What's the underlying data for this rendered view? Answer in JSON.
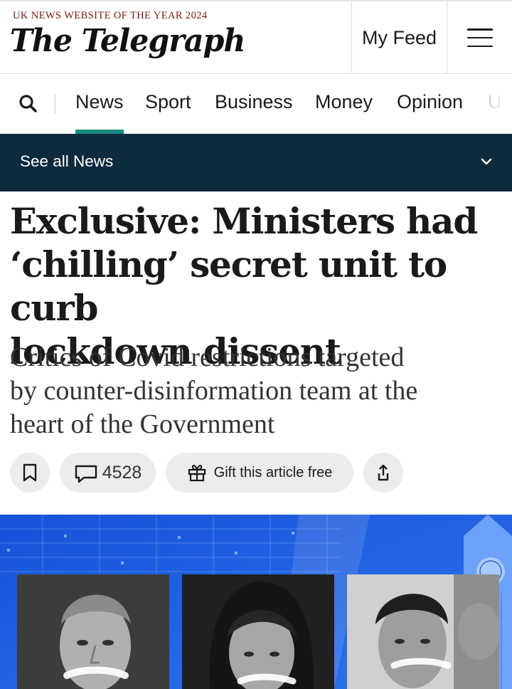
{
  "masthead": {
    "award": "UK NEWS WEBSITE OF THE YEAR 2024",
    "logo_text": "The Telegraph",
    "my_feed_label": "My Feed",
    "menu_icon": "hamburger-icon"
  },
  "nav": {
    "search_icon": "search-icon",
    "items": [
      {
        "label": "News",
        "active": true
      },
      {
        "label": "Sport",
        "active": false
      },
      {
        "label": "Business",
        "active": false
      },
      {
        "label": "Money",
        "active": false
      },
      {
        "label": "Opinion",
        "active": false
      },
      {
        "label": "U",
        "active": false
      }
    ],
    "active_color": "#1a8a80"
  },
  "section_bar": {
    "label": "See all News",
    "icon": "chevron-down-icon",
    "background": "#0e2a3d"
  },
  "article": {
    "headline_lines": [
      "Exclusive: Ministers had",
      "‘chilling’ secret unit to curb",
      "lockdown dissent"
    ],
    "standfirst_lines": [
      "Critics of Covid restrictions targeted",
      "by counter-disinformation team at the",
      "heart of the Government"
    ],
    "actions": {
      "bookmark_icon": "bookmark-icon",
      "comment_icon": "comment-icon",
      "comment_count": "4528",
      "gift_icon": "gift-icon",
      "gift_label": "Gift this article free",
      "share_icon": "share-icon"
    }
  },
  "hero": {
    "background": "#1e5fe0",
    "portraits": [
      "portrait-man-left",
      "portrait-woman-center",
      "portrait-man-right"
    ]
  }
}
